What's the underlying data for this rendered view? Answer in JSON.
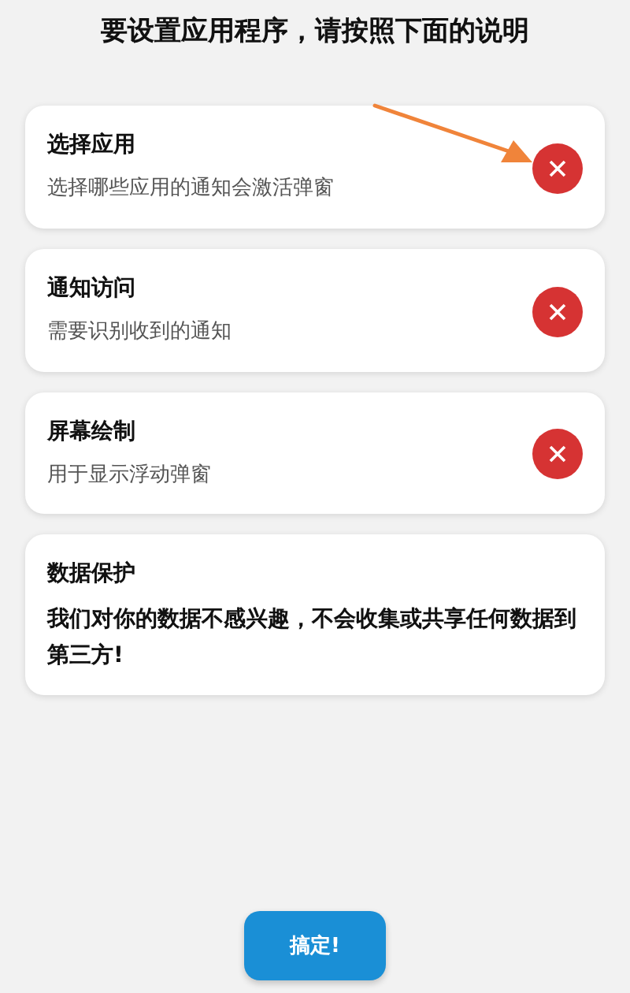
{
  "heading": "要设置应用程序，请按照下面的说明",
  "cards": [
    {
      "kind": "permission",
      "title": "选择应用",
      "description": "选择哪些应用的通知会激活弹窗",
      "granted": false,
      "pointed_at": true
    },
    {
      "kind": "permission",
      "title": "通知访问",
      "description": "需要识别收到的通知",
      "granted": false,
      "pointed_at": false
    },
    {
      "kind": "permission",
      "title": "屏幕绘制",
      "description": "用于显示浮动弹窗",
      "granted": false,
      "pointed_at": false
    },
    {
      "kind": "info",
      "title": "数据保护",
      "description": "我们对你的数据不感兴趣，不会收集或共享任何数据到第三方!"
    }
  ],
  "done_button": "搞定!"
}
